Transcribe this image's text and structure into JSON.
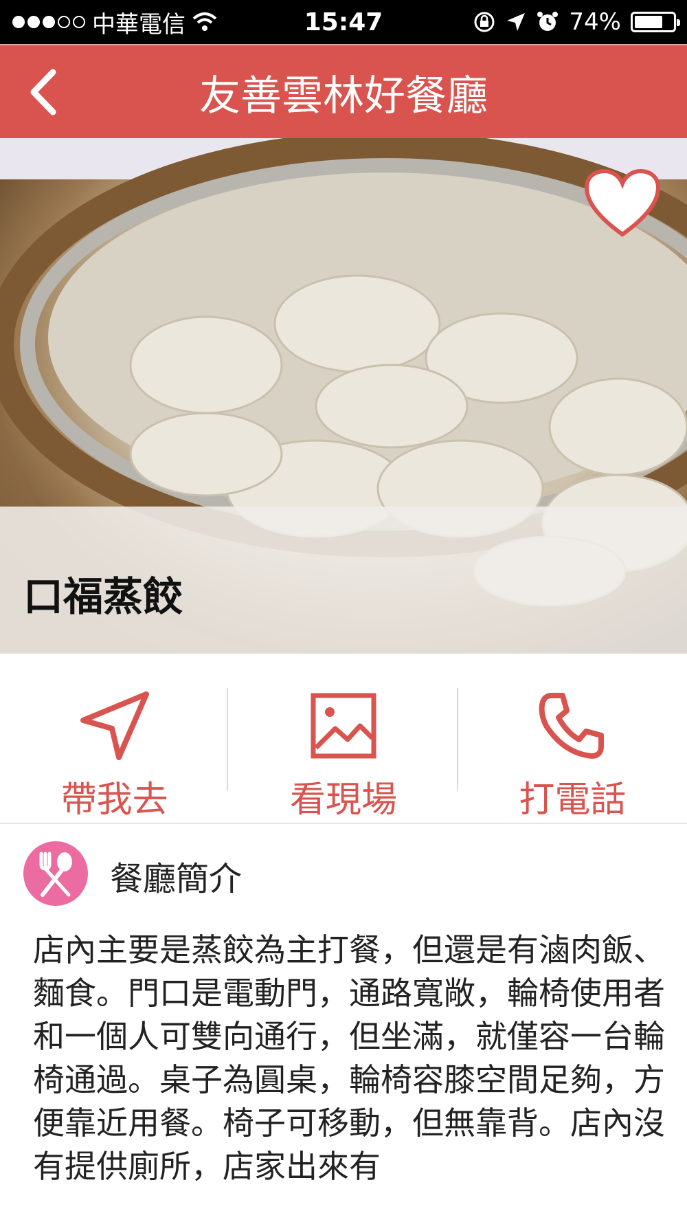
{
  "status_bar": {
    "carrier": "中華電信",
    "time": "15:47",
    "battery": "74%",
    "battery_level": 0.74
  },
  "header": {
    "title": "友善雲林好餐廳"
  },
  "restaurant": {
    "name": "口福蒸餃"
  },
  "actions": [
    {
      "label": "帶我去",
      "icon": "navigate-icon"
    },
    {
      "label": "看現場",
      "icon": "image-icon"
    },
    {
      "label": "打電話",
      "icon": "phone-icon"
    }
  ],
  "intro": {
    "title": "餐廳簡介",
    "body": "店內主要是蒸餃為主打餐，但還是有滷肉飯、麵食。門口是電動門，通路寬敞，輪椅使用者和一個人可雙向通行，但坐滿，就僅容一台輪椅通過。桌子為圓桌，輪椅容膝空間足夠，方便靠近用餐。椅子可移動，但無靠背。店內沒有提供廁所，店家出來有"
  },
  "colors": {
    "accent": "#d9534f",
    "intro_icon": "#ec6ba0"
  }
}
